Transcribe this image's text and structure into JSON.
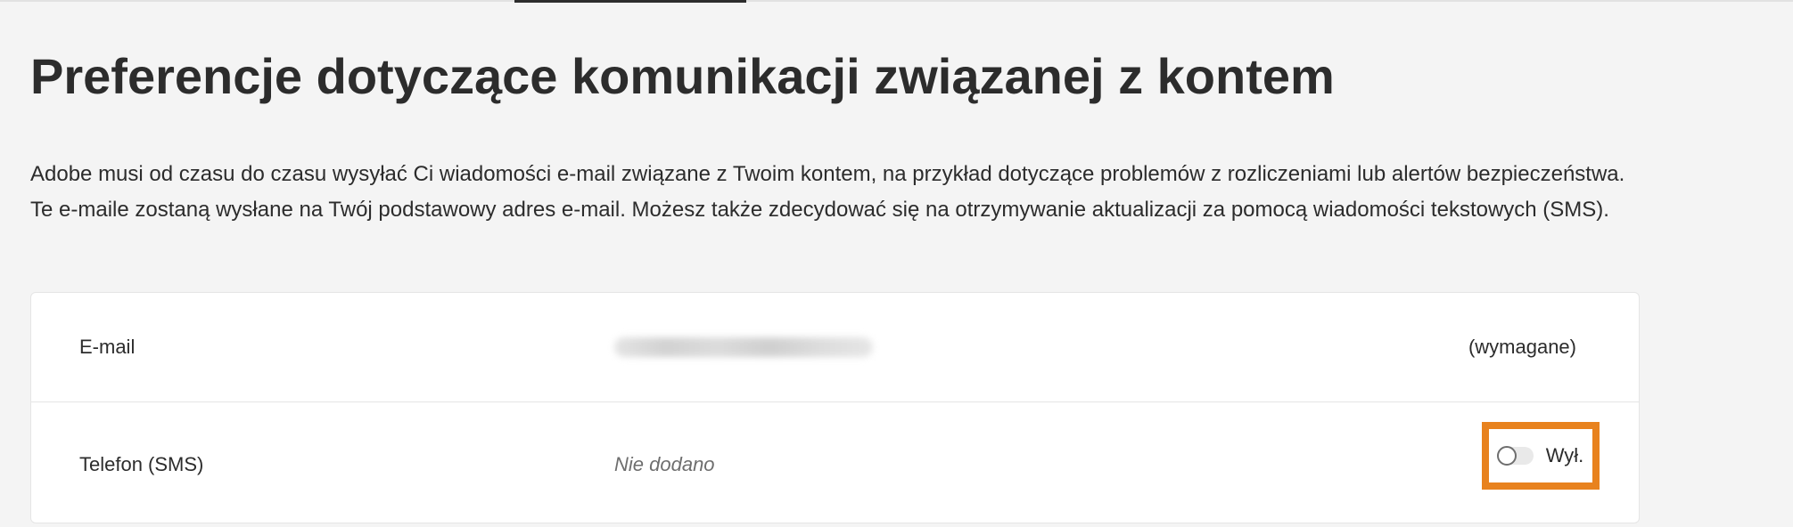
{
  "header": {
    "title": "Preferencje dotyczące komunikacji związanej z kontem",
    "description": "Adobe musi od czasu do czasu wysyłać Ci wiadomości e-mail związane z Twoim kontem, na przykład dotyczące problemów z rozliczeniami lub alertów bezpieczeństwa. Te e-maile zostaną wysłane na Twój podstawowy adres e-mail. Możesz także zdecydować się na otrzymywanie aktualizacji za pomocą wiadomości tekstowych (SMS)."
  },
  "preferences": {
    "email": {
      "label": "E-mail",
      "status": "(wymagane)"
    },
    "phone": {
      "label": "Telefon (SMS)",
      "value": "Nie dodano",
      "toggle_label": "Wył.",
      "toggle_on": false
    }
  },
  "colors": {
    "background": "#f4f4f4",
    "card": "#ffffff",
    "highlight": "#e8821e",
    "text": "#2c2c2c",
    "muted": "#6e6e6e"
  }
}
